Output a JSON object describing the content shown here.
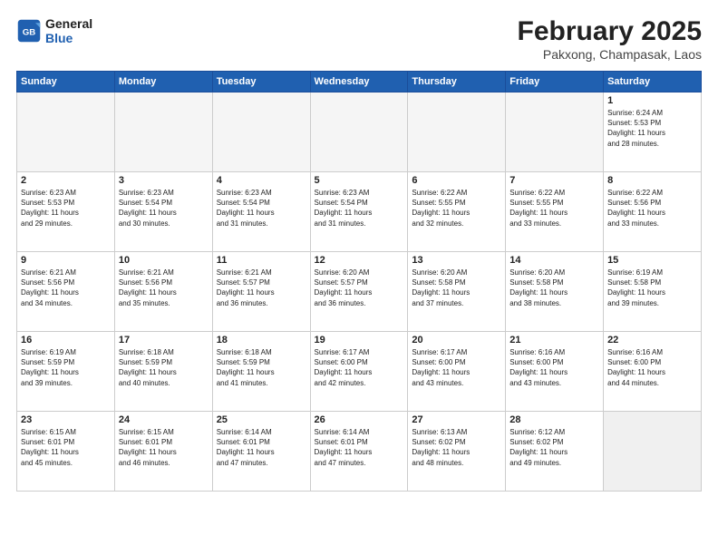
{
  "header": {
    "logo_line1": "General",
    "logo_line2": "Blue",
    "title": "February 2025",
    "subtitle": "Pakxong, Champasak, Laos"
  },
  "days_of_week": [
    "Sunday",
    "Monday",
    "Tuesday",
    "Wednesday",
    "Thursday",
    "Friday",
    "Saturday"
  ],
  "weeks": [
    [
      {
        "num": "",
        "info": "",
        "empty": true
      },
      {
        "num": "",
        "info": "",
        "empty": true
      },
      {
        "num": "",
        "info": "",
        "empty": true
      },
      {
        "num": "",
        "info": "",
        "empty": true
      },
      {
        "num": "",
        "info": "",
        "empty": true
      },
      {
        "num": "",
        "info": "",
        "empty": true
      },
      {
        "num": "1",
        "info": "Sunrise: 6:24 AM\nSunset: 5:53 PM\nDaylight: 11 hours\nand 28 minutes.",
        "empty": false
      }
    ],
    [
      {
        "num": "2",
        "info": "Sunrise: 6:23 AM\nSunset: 5:53 PM\nDaylight: 11 hours\nand 29 minutes.",
        "empty": false
      },
      {
        "num": "3",
        "info": "Sunrise: 6:23 AM\nSunset: 5:54 PM\nDaylight: 11 hours\nand 30 minutes.",
        "empty": false
      },
      {
        "num": "4",
        "info": "Sunrise: 6:23 AM\nSunset: 5:54 PM\nDaylight: 11 hours\nand 31 minutes.",
        "empty": false
      },
      {
        "num": "5",
        "info": "Sunrise: 6:23 AM\nSunset: 5:54 PM\nDaylight: 11 hours\nand 31 minutes.",
        "empty": false
      },
      {
        "num": "6",
        "info": "Sunrise: 6:22 AM\nSunset: 5:55 PM\nDaylight: 11 hours\nand 32 minutes.",
        "empty": false
      },
      {
        "num": "7",
        "info": "Sunrise: 6:22 AM\nSunset: 5:55 PM\nDaylight: 11 hours\nand 33 minutes.",
        "empty": false
      },
      {
        "num": "8",
        "info": "Sunrise: 6:22 AM\nSunset: 5:56 PM\nDaylight: 11 hours\nand 33 minutes.",
        "empty": false
      }
    ],
    [
      {
        "num": "9",
        "info": "Sunrise: 6:21 AM\nSunset: 5:56 PM\nDaylight: 11 hours\nand 34 minutes.",
        "empty": false
      },
      {
        "num": "10",
        "info": "Sunrise: 6:21 AM\nSunset: 5:56 PM\nDaylight: 11 hours\nand 35 minutes.",
        "empty": false
      },
      {
        "num": "11",
        "info": "Sunrise: 6:21 AM\nSunset: 5:57 PM\nDaylight: 11 hours\nand 36 minutes.",
        "empty": false
      },
      {
        "num": "12",
        "info": "Sunrise: 6:20 AM\nSunset: 5:57 PM\nDaylight: 11 hours\nand 36 minutes.",
        "empty": false
      },
      {
        "num": "13",
        "info": "Sunrise: 6:20 AM\nSunset: 5:58 PM\nDaylight: 11 hours\nand 37 minutes.",
        "empty": false
      },
      {
        "num": "14",
        "info": "Sunrise: 6:20 AM\nSunset: 5:58 PM\nDaylight: 11 hours\nand 38 minutes.",
        "empty": false
      },
      {
        "num": "15",
        "info": "Sunrise: 6:19 AM\nSunset: 5:58 PM\nDaylight: 11 hours\nand 39 minutes.",
        "empty": false
      }
    ],
    [
      {
        "num": "16",
        "info": "Sunrise: 6:19 AM\nSunset: 5:59 PM\nDaylight: 11 hours\nand 39 minutes.",
        "empty": false
      },
      {
        "num": "17",
        "info": "Sunrise: 6:18 AM\nSunset: 5:59 PM\nDaylight: 11 hours\nand 40 minutes.",
        "empty": false
      },
      {
        "num": "18",
        "info": "Sunrise: 6:18 AM\nSunset: 5:59 PM\nDaylight: 11 hours\nand 41 minutes.",
        "empty": false
      },
      {
        "num": "19",
        "info": "Sunrise: 6:17 AM\nSunset: 6:00 PM\nDaylight: 11 hours\nand 42 minutes.",
        "empty": false
      },
      {
        "num": "20",
        "info": "Sunrise: 6:17 AM\nSunset: 6:00 PM\nDaylight: 11 hours\nand 43 minutes.",
        "empty": false
      },
      {
        "num": "21",
        "info": "Sunrise: 6:16 AM\nSunset: 6:00 PM\nDaylight: 11 hours\nand 43 minutes.",
        "empty": false
      },
      {
        "num": "22",
        "info": "Sunrise: 6:16 AM\nSunset: 6:00 PM\nDaylight: 11 hours\nand 44 minutes.",
        "empty": false
      }
    ],
    [
      {
        "num": "23",
        "info": "Sunrise: 6:15 AM\nSunset: 6:01 PM\nDaylight: 11 hours\nand 45 minutes.",
        "empty": false
      },
      {
        "num": "24",
        "info": "Sunrise: 6:15 AM\nSunset: 6:01 PM\nDaylight: 11 hours\nand 46 minutes.",
        "empty": false
      },
      {
        "num": "25",
        "info": "Sunrise: 6:14 AM\nSunset: 6:01 PM\nDaylight: 11 hours\nand 47 minutes.",
        "empty": false
      },
      {
        "num": "26",
        "info": "Sunrise: 6:14 AM\nSunset: 6:01 PM\nDaylight: 11 hours\nand 47 minutes.",
        "empty": false
      },
      {
        "num": "27",
        "info": "Sunrise: 6:13 AM\nSunset: 6:02 PM\nDaylight: 11 hours\nand 48 minutes.",
        "empty": false
      },
      {
        "num": "28",
        "info": "Sunrise: 6:12 AM\nSunset: 6:02 PM\nDaylight: 11 hours\nand 49 minutes.",
        "empty": false
      },
      {
        "num": "",
        "info": "",
        "empty": true,
        "shaded": true
      }
    ]
  ]
}
